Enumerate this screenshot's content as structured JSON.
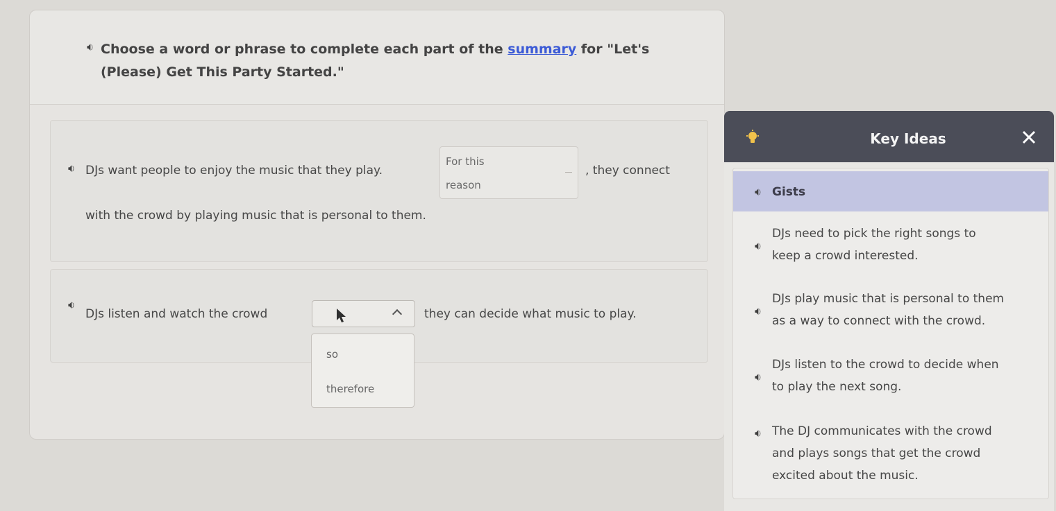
{
  "prompt": {
    "text_before": "Choose a word or phrase to complete each part of the ",
    "link_word": "summary",
    "text_after": " for \"Let's (Please) Get This Party Started.\""
  },
  "question1": {
    "text_before": "DJs want people to enjoy the music that they play.",
    "answer_line1": "For this",
    "answer_line2": "reason",
    "text_after": ", they connect",
    "text_line2": "with the crowd by playing music that is personal to them."
  },
  "question2": {
    "text_before": "DJs listen and watch the crowd",
    "text_after": "they can decide what music to play.",
    "options": [
      "so",
      "therefore"
    ]
  },
  "key_ideas": {
    "title": "Key Ideas",
    "gists_label": "Gists",
    "items": [
      {
        "line1": "DJs need to pick the right songs to",
        "line2": "keep a crowd interested."
      },
      {
        "line1": "DJs play music that is personal to them",
        "line2": "as a way to connect with the crowd."
      },
      {
        "line1": "DJs listen to the crowd to decide when",
        "line2": "to play the next song."
      },
      {
        "line1": "The DJ communicates with the crowd",
        "line2": "and plays songs that get the crowd",
        "line3": "excited about the music."
      }
    ]
  },
  "colors": {
    "link": "#3c5bd6",
    "header_bg": "#4b4d58",
    "gists_bg": "#c2c5e2",
    "bulb": "#f1c24b"
  },
  "icons": {
    "speaker": "speaker-icon",
    "bulb": "lightbulb-icon",
    "close": "close-icon",
    "cursor": "mouse-cursor-icon",
    "caret": "chevron-up-icon"
  }
}
